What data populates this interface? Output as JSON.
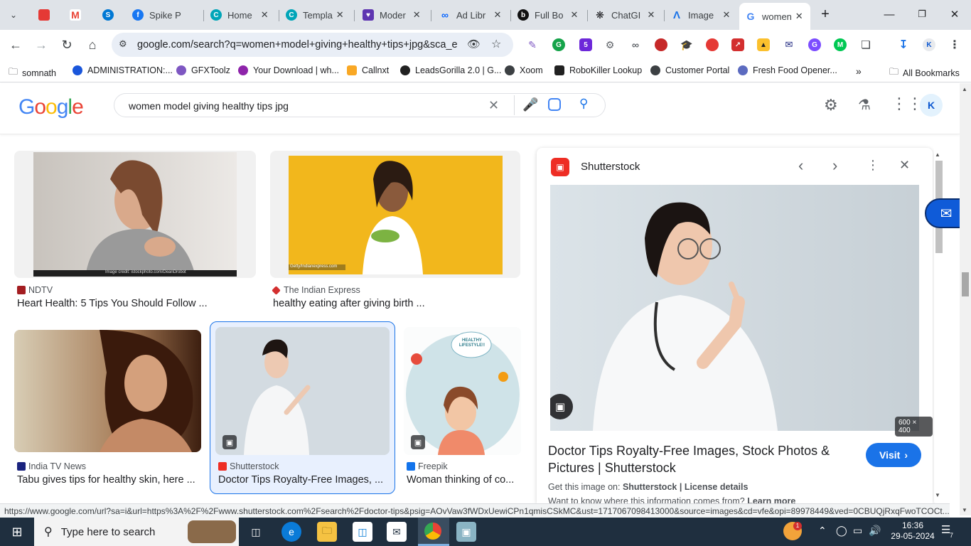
{
  "tabs": [
    {
      "title": "",
      "icon": "chevron-down-icon"
    },
    {
      "title": "",
      "icon": "mail-icon"
    },
    {
      "title": "",
      "icon": "gmail-icon"
    },
    {
      "title": "",
      "icon": "skype-icon"
    },
    {
      "title": "Spike P",
      "icon": "facebook-icon"
    },
    {
      "title": "Home",
      "icon": "canva-icon"
    },
    {
      "title": "Templa",
      "icon": "canva-icon"
    },
    {
      "title": "Moder",
      "icon": "shield-heart-icon"
    },
    {
      "title": "Ad Libr",
      "icon": "meta-icon"
    },
    {
      "title": "Full Bo",
      "icon": "shop-icon"
    },
    {
      "title": "ChatGI",
      "icon": "chatgpt-icon"
    },
    {
      "title": "Image",
      "icon": "drive-icon"
    },
    {
      "title": "women",
      "icon": "google-icon"
    }
  ],
  "toolbar": {
    "url": "google.com/search?q=women+model+giving+healthy+tips+jpg&sca_e..."
  },
  "bookmarks": [
    {
      "label": "somnath",
      "color": "#5f6368"
    },
    {
      "label": "ADMINISTRATION:...",
      "color": "#1a56db"
    },
    {
      "label": "GFXToolz",
      "color": "#7e57c2"
    },
    {
      "label": "Your Download | wh...",
      "color": "#8e24aa"
    },
    {
      "label": "Callnxt",
      "color": "#f9a825"
    },
    {
      "label": "LeadsGorilla 2.0 | G...",
      "color": "#212121"
    },
    {
      "label": "Xoom",
      "color": "#3c4043"
    },
    {
      "label": "RoboKiller Lookup",
      "color": "#212121"
    },
    {
      "label": "Customer Portal",
      "color": "#3c4043"
    },
    {
      "label": "Fresh Food Opener...",
      "color": "#5c6bc0"
    }
  ],
  "all_bookmarks": "All Bookmarks",
  "google": {
    "logo": "Google",
    "query": "women model giving healthy tips jpg"
  },
  "results": [
    {
      "source": "NDTV",
      "title": "Heart Health: 5 Tips You Should Follow ...",
      "credit": "Image credit: istockphoto.com/DeanDrobot"
    },
    {
      "source": "The Indian Express",
      "title": "healthy eating after giving birth ...",
      "credit": "Getty/Indianexpress.com"
    },
    {
      "source": "India TV News",
      "title": "Tabu gives tips for healthy skin, here ..."
    },
    {
      "source": "Shutterstock",
      "title": "Doctor Tips Royalty-Free Images, ..."
    },
    {
      "source": "Freepik",
      "title": "Woman thinking of co..."
    }
  ],
  "freepik_thumb_text": [
    "HEALTHY",
    "LIFESTYLE!!"
  ],
  "panel": {
    "source": "Shutterstock",
    "dimensions": "600 × 400",
    "title": "Doctor Tips Royalty-Free Images, Stock Photos & Pictures | Shutterstock",
    "visit": "Visit",
    "get_image_label": "Get this image on:",
    "get_image_source": "Shutterstock",
    "license": "License details",
    "more_prefix": "Want to know where this information comes from?",
    "learn_more": "Learn more"
  },
  "status_url": "https://www.google.com/url?sa=i&url=https%3A%2F%2Fwww.shutterstock.com%2Fsearch%2Fdoctor-tips&psig=AOvVaw3fWDxUewiCPn1qmisCSkMC&ust=1717067098413000&source=images&cd=vfe&opi=89978449&ved=0CBUQjRxqFwoTCOCt...",
  "taskbar": {
    "search_placeholder": "Type here to search",
    "time": "16:36",
    "date": "29-05-2024",
    "notification_count": "7",
    "weather_badge": "1"
  }
}
